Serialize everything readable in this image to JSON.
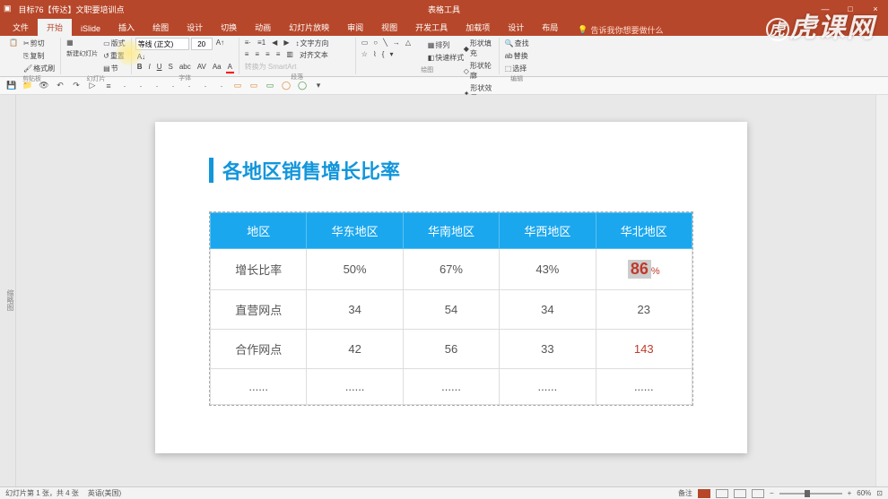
{
  "titlebar": {
    "doc_name": "目标76【传达】文职要培训点",
    "context_tab": "表格工具",
    "win_min": "—",
    "win_max": "□",
    "win_close": "×"
  },
  "tabs": {
    "file": "文件",
    "home": "开始",
    "islide": "iSlide",
    "insert": "插入",
    "draw": "绘图",
    "design": "设计",
    "transitions": "切换",
    "animations": "动画",
    "slideshow": "幻灯片放映",
    "review": "审阅",
    "view": "视图",
    "developer": "开发工具",
    "addin": "加载项",
    "design2": "设计",
    "layout": "布局",
    "search_placeholder": "告诉我你想要做什么"
  },
  "ribbon": {
    "clipboard": {
      "copy": "复制",
      "cut": "剪切",
      "paste": "粘贴",
      "formatpainter": "格式刷",
      "label": "剪贴板"
    },
    "slides": {
      "new": "新建幻灯片",
      "layout": "版式",
      "reset": "重置",
      "section": "节",
      "label": "幻灯片"
    },
    "font": {
      "name": "等线 (正文)",
      "size": "20",
      "label": "字体"
    },
    "paragraph": {
      "direction": "文字方向",
      "align": "对齐文本",
      "smartart": "转换为 SmartArt",
      "label": "段落"
    },
    "drawing": {
      "arrange": "排列",
      "quickstyle": "快速样式",
      "shapefill": "形状填充",
      "shapeoutline": "形状轮廓",
      "shapeeffects": "形状效果",
      "label": "绘图"
    },
    "editing": {
      "find": "查找",
      "replace": "替换",
      "select": "选择",
      "label": "编辑"
    }
  },
  "slide": {
    "title": "各地区销售增长比率",
    "headers": [
      "地区",
      "华东地区",
      "华南地区",
      "华西地区",
      "华北地区"
    ],
    "rows": [
      {
        "label": "增长比率",
        "cells": [
          "50%",
          "67%",
          "43%",
          "86%"
        ],
        "highlight_idx": 3
      },
      {
        "label": "直营网点",
        "cells": [
          "34",
          "54",
          "34",
          "23"
        ]
      },
      {
        "label": "合作网点",
        "cells": [
          "42",
          "56",
          "33",
          "143"
        ],
        "red_idx": 3
      },
      {
        "label": "......",
        "cells": [
          "......",
          "......",
          "......",
          "......"
        ]
      }
    ]
  },
  "statusbar": {
    "slide_info": "幻灯片第 1 张，共 4 张",
    "lang": "英语(美国)",
    "notes": "备注",
    "zoom": "60%",
    "fit": "⊡"
  },
  "watermark": "虎课网",
  "sidebar": {
    "label": "缩略图"
  }
}
